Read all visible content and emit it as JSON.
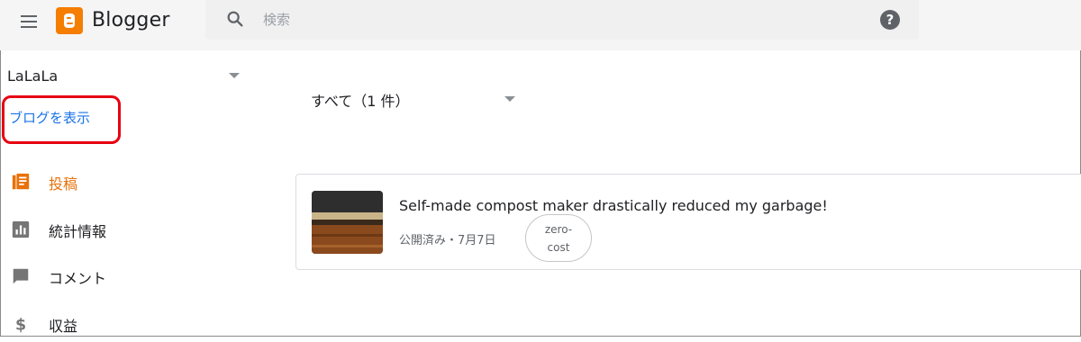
{
  "header": {
    "brand": "Blogger",
    "search_placeholder": "検索",
    "help_icon": "help-icon"
  },
  "sidebar": {
    "blog_name": "LaLaLa",
    "view_blog_label": "ブログを表示",
    "items": [
      {
        "label": "投稿",
        "icon": "posts-icon",
        "active": true
      },
      {
        "label": "統計情報",
        "icon": "stats-icon",
        "active": false
      },
      {
        "label": "コメント",
        "icon": "comment-icon",
        "active": false
      },
      {
        "label": "収益",
        "icon": "dollar-icon",
        "active": false
      }
    ]
  },
  "main": {
    "filter_label": "すべて（1 件）",
    "posts": [
      {
        "title": "Self-made compost maker drastically reduced my garbage!",
        "meta": "公開済み・7月7日",
        "label_line1": "zero-",
        "label_line2": "cost"
      }
    ]
  },
  "colors": {
    "accent_orange": "#e8710a",
    "link_blue": "#1a73e8",
    "highlight_red": "#e60012",
    "blogger_logo": "#f57d00"
  }
}
